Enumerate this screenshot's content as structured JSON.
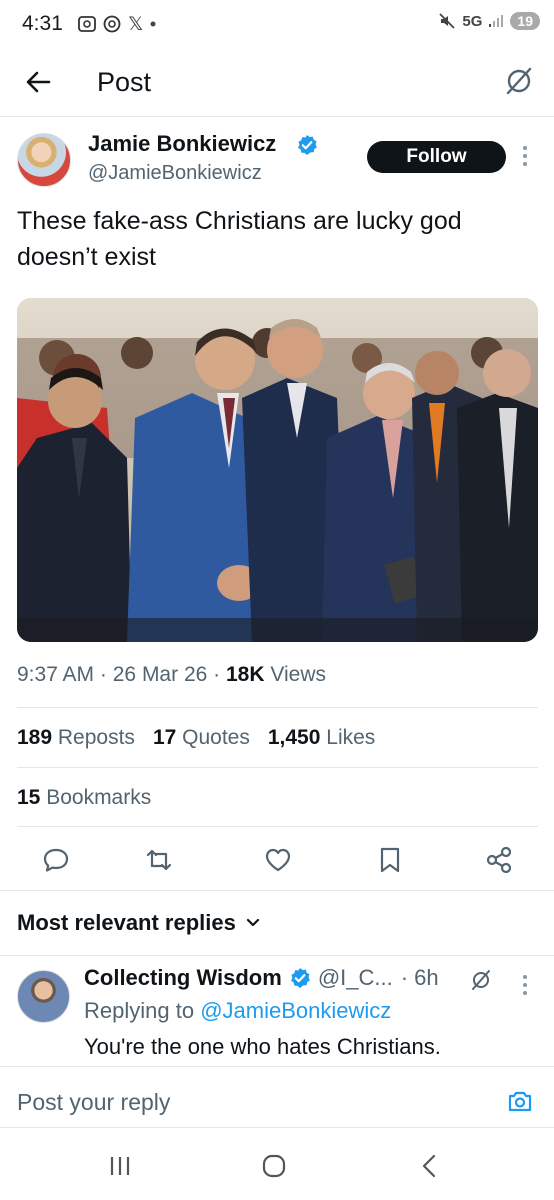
{
  "status_bar": {
    "time": "4:31",
    "left_icons": [
      "screenshot-icon",
      "threads-icon",
      "x-icon",
      "dot-icon"
    ],
    "x_glyph": "𝕏",
    "network": "5G",
    "battery": "19"
  },
  "header": {
    "title": "Post"
  },
  "tweet": {
    "author_name": "Jamie Bonkiewicz",
    "author_handle": "@JamieBonkiewicz",
    "follow_label": "Follow",
    "text": "These fake-ass Christians are lucky god doesn’t exist",
    "time": "9:37 AM",
    "date": "26 Mar 26",
    "views_count": "18K",
    "views_label": "Views",
    "reposts_count": "189",
    "reposts_label": "Reposts",
    "quotes_count": "17",
    "quotes_label": "Quotes",
    "likes_count": "1,450",
    "likes_label": "Likes",
    "bookmarks_count": "15",
    "bookmarks_label": "Bookmarks"
  },
  "replies": {
    "sort_label": "Most relevant replies",
    "items": [
      {
        "name": "Collecting Wisdom",
        "handle": "@I_C...",
        "time": "· 6h",
        "replying_prefix": "Replying to",
        "replying_handle": "@JamieBonkiewicz",
        "text": "You're the one who hates Christians."
      }
    ]
  },
  "compose": {
    "placeholder": "Post your reply"
  },
  "colors": {
    "accent": "#1d9bf0",
    "text_primary": "#0f1419",
    "text_secondary": "#536471",
    "follow_bg": "#0f1419"
  }
}
